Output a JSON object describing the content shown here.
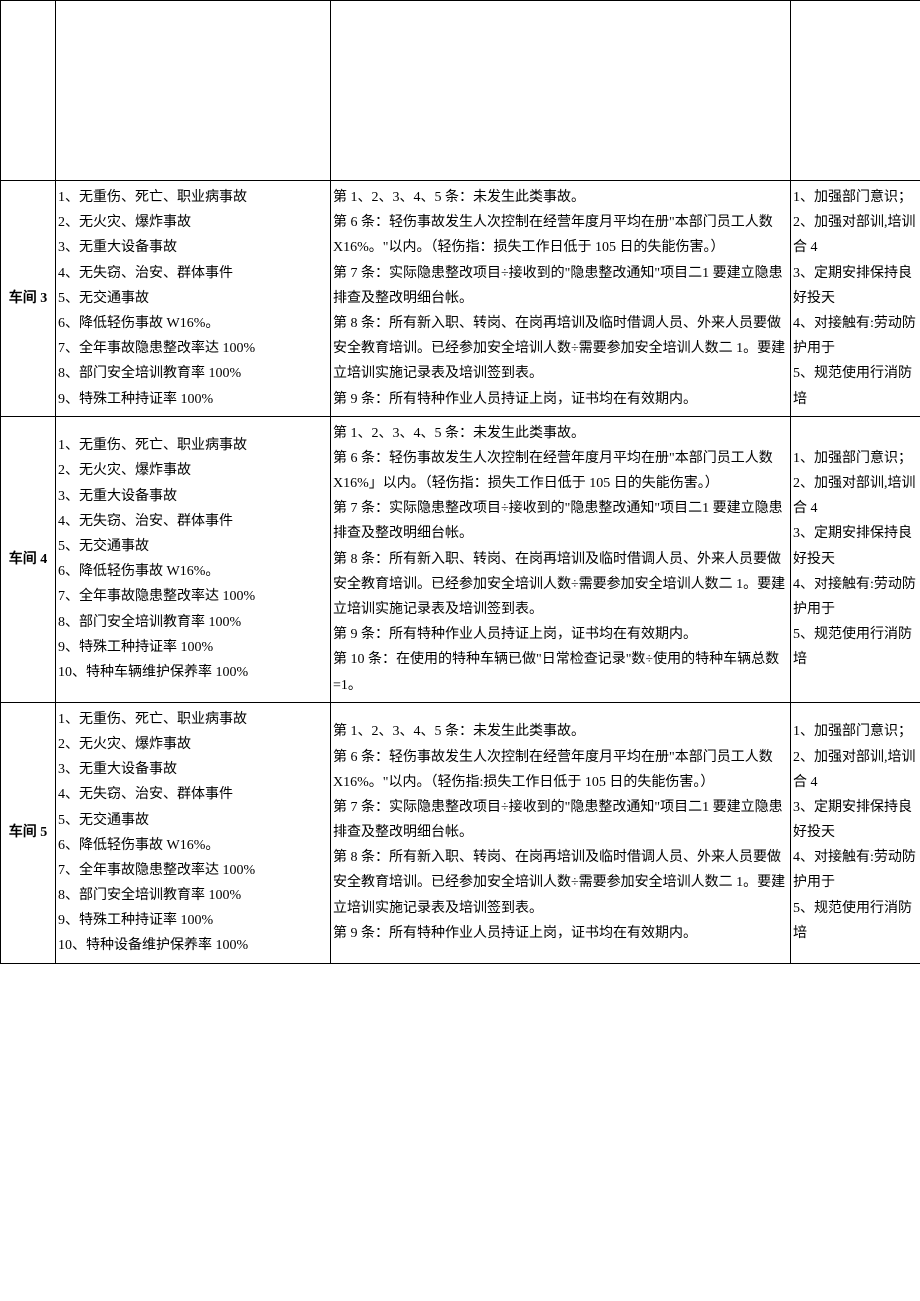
{
  "rows": [
    {
      "label": "车间 3",
      "targets": [
        "1、无重伤、死亡、职业病事故",
        "2、无火灾、爆炸事故",
        "3、无重大设备事故",
        "4、无失窃、治安、群体事件",
        "5、无交通事故",
        "6、降低轻伤事故 W16%。",
        "7、全年事故隐患整改率达 100%",
        "8、部门安全培训教育率 100%",
        "9、特殊工种持证率 100%"
      ],
      "criteria": [
        "第 1、2、3、4、5 条：未发生此类事故。",
        "第 6 条：轻伤事故发生人次控制在经营年度月平均在册\"本部门员工人数 X16%。\"以内。（轻伤指：损失工作日低于 105 日的失能伤害。）",
        "第 7 条：实际隐患整改项目÷接收到的\"隐患整改通知\"项目二1 要建立隐患排查及整改明细台帐。",
        "第 8 条：所有新入职、转岗、在岗再培训及临时借调人员、外来人员要做安全教育培训。已经参加安全培训人数÷需要参加安全培训人数二 1。要建立培训实施记录表及培训签到表。",
        "第 9 条：所有特种作业人员持证上岗，证书均在有效期内。"
      ],
      "measures": [
        "1、加强部门意识；",
        "2、加强对部训,培训合 4",
        "3、定期安排保持良好投天",
        "4、对接触有:劳动防护用于",
        "5、规范使用行消防培"
      ]
    },
    {
      "label": "车间 4",
      "targets": [
        "1、无重伤、死亡、职业病事故",
        "2、无火灾、爆炸事故",
        "3、无重大设备事故",
        "4、无失窃、治安、群体事件",
        "5、无交通事故",
        "6、降低轻伤事故 W16%。",
        "7、全年事故隐患整改率达 100%",
        "8、部门安全培训教育率 100%",
        "9、特殊工种持证率 100%",
        "10、特种车辆维护保养率 100%"
      ],
      "criteria": [
        "第 1、2、3、4、5 条：未发生此类事故。",
        "第 6 条：轻伤事故发生人次控制在经营年度月平均在册\"本部门员工人数 X16%」以内。（轻伤指：损失工作日低于 105 日的失能伤害。）",
        "第 7 条：实际隐患整改项目÷接收到的\"隐患整改通知\"项目二1 要建立隐患排查及整改明细台帐。",
        "第 8 条：所有新入职、转岗、在岗再培训及临时借调人员、外来人员要做安全教育培训。已经参加安全培训人数÷需要参加安全培训人数二 1。要建立培训实施记录表及培训签到表。",
        "第 9 条：所有特种作业人员持证上岗，证书均在有效期内。",
        "第 10 条：在使用的特种车辆已做\"日常检查记录\"数÷使用的特种车辆总数=1。"
      ],
      "measures": [
        "1、加强部门意识；",
        "2、加强对部训,培训合 4",
        "3、定期安排保持良好投天",
        "4、对接触有:劳动防护用于",
        "5、规范使用行消防培"
      ]
    },
    {
      "label": "车间 5",
      "targets": [
        "1、无重伤、死亡、职业病事故",
        "2、无火灾、爆炸事故",
        "3、无重大设备事故",
        "4、无失窃、治安、群体事件",
        "5、无交通事故",
        "6、降低轻伤事故 W16%。",
        "7、全年事故隐患整改率达 100%",
        "8、部门安全培训教育率 100%",
        "9、特殊工种持证率 100%",
        "10、特种设备维护保养率 100%"
      ],
      "criteria": [
        "第 1、2、3、4、5 条：未发生此类事故。",
        "第 6 条：轻伤事故发生人次控制在经营年度月平均在册\"本部门员工人数 X16%。\"以内。（轻伤指:损失工作日低于 105 日的失能伤害。）",
        "第 7 条：实际隐患整改项目÷接收到的\"隐患整改通知\"项目二1 要建立隐患排查及整改明细台帐。",
        "第 8 条：所有新入职、转岗、在岗再培训及临时借调人员、外来人员要做安全教育培训。已经参加安全培训人数÷需要参加安全培训人数二 1。要建立培训实施记录表及培训签到表。",
        "第 9 条：所有特种作业人员持证上岗，证书均在有效期内。"
      ],
      "measures": [
        "1、加强部门意识；",
        "2、加强对部训,培训合 4",
        "3、定期安排保持良好投天",
        "4、对接触有:劳动防护用于",
        "5、规范使用行消防培"
      ]
    }
  ]
}
